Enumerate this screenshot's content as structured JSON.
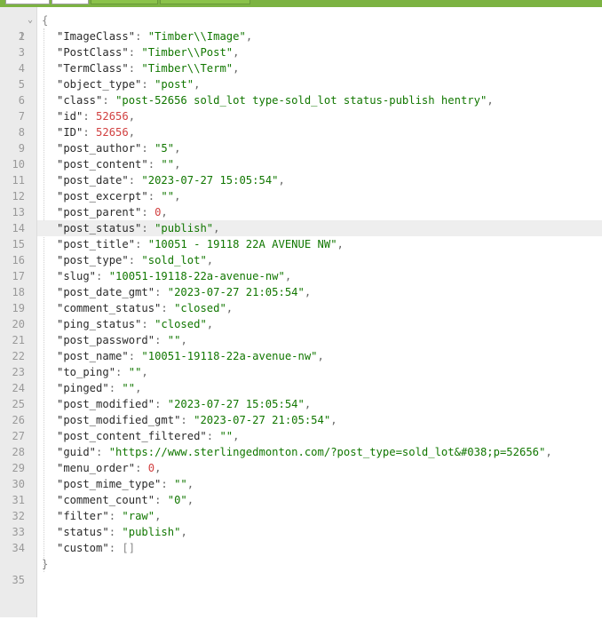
{
  "colors": {
    "accent": "#7cb342",
    "string": "#117700",
    "number": "#d14040",
    "key": "#2b2b2b",
    "punctuation": "#666666",
    "gutter": "#ebebeb"
  },
  "editor": {
    "active_line": 14,
    "fold_icon": "chevron-down-icon",
    "open_brace": "{",
    "close_brace": "}",
    "lines": [
      {
        "n": "2",
        "k": "\"ImageClass\"",
        "t": "str",
        "v": "\"Timber\\\\Image\""
      },
      {
        "n": "3",
        "k": "\"PostClass\"",
        "t": "str",
        "v": "\"Timber\\\\Post\""
      },
      {
        "n": "4",
        "k": "\"TermClass\"",
        "t": "str",
        "v": "\"Timber\\\\Term\""
      },
      {
        "n": "5",
        "k": "\"object_type\"",
        "t": "str",
        "v": "\"post\""
      },
      {
        "n": "6",
        "k": "\"class\"",
        "t": "str",
        "v": "\"post-52656 sold_lot type-sold_lot status-publish hentry\""
      },
      {
        "n": "7",
        "k": "\"id\"",
        "t": "num",
        "v": "52656"
      },
      {
        "n": "8",
        "k": "\"ID\"",
        "t": "num",
        "v": "52656"
      },
      {
        "n": "9",
        "k": "\"post_author\"",
        "t": "str",
        "v": "\"5\""
      },
      {
        "n": "10",
        "k": "\"post_content\"",
        "t": "str",
        "v": "\"\""
      },
      {
        "n": "11",
        "k": "\"post_date\"",
        "t": "str",
        "v": "\"2023-07-27 15:05:54\""
      },
      {
        "n": "12",
        "k": "\"post_excerpt\"",
        "t": "str",
        "v": "\"\""
      },
      {
        "n": "13",
        "k": "\"post_parent\"",
        "t": "num",
        "v": "0"
      },
      {
        "n": "14",
        "k": "\"post_status\"",
        "t": "str",
        "v": "\"publish\""
      },
      {
        "n": "15",
        "k": "\"post_title\"",
        "t": "str",
        "v": "\"10051 - 19118 22A AVENUE NW\""
      },
      {
        "n": "16",
        "k": "\"post_type\"",
        "t": "str",
        "v": "\"sold_lot\""
      },
      {
        "n": "17",
        "k": "\"slug\"",
        "t": "str",
        "v": "\"10051-19118-22a-avenue-nw\""
      },
      {
        "n": "18",
        "k": "\"post_date_gmt\"",
        "t": "str",
        "v": "\"2023-07-27 21:05:54\""
      },
      {
        "n": "19",
        "k": "\"comment_status\"",
        "t": "str",
        "v": "\"closed\""
      },
      {
        "n": "20",
        "k": "\"ping_status\"",
        "t": "str",
        "v": "\"closed\""
      },
      {
        "n": "21",
        "k": "\"post_password\"",
        "t": "str",
        "v": "\"\""
      },
      {
        "n": "22",
        "k": "\"post_name\"",
        "t": "str",
        "v": "\"10051-19118-22a-avenue-nw\""
      },
      {
        "n": "23",
        "k": "\"to_ping\"",
        "t": "str",
        "v": "\"\""
      },
      {
        "n": "24",
        "k": "\"pinged\"",
        "t": "str",
        "v": "\"\""
      },
      {
        "n": "25",
        "k": "\"post_modified\"",
        "t": "str",
        "v": "\"2023-07-27 15:05:54\""
      },
      {
        "n": "26",
        "k": "\"post_modified_gmt\"",
        "t": "str",
        "v": "\"2023-07-27 21:05:54\""
      },
      {
        "n": "27",
        "k": "\"post_content_filtered\"",
        "t": "str",
        "v": "\"\""
      },
      {
        "n": "28",
        "k": "\"guid\"",
        "t": "str",
        "v": "\"https://www.sterlingedmonton.com/?post_type=sold_lot&#038;p=52656\""
      },
      {
        "n": "29",
        "k": "\"menu_order\"",
        "t": "num",
        "v": "0"
      },
      {
        "n": "30",
        "k": "\"post_mime_type\"",
        "t": "str",
        "v": "\"\""
      },
      {
        "n": "31",
        "k": "\"comment_count\"",
        "t": "str",
        "v": "\"0\""
      },
      {
        "n": "32",
        "k": "\"filter\"",
        "t": "str",
        "v": "\"raw\""
      },
      {
        "n": "33",
        "k": "\"status\"",
        "t": "str",
        "v": "\"publish\""
      },
      {
        "n": "34",
        "k": "\"custom\"",
        "t": "arr",
        "v": "[]"
      }
    ],
    "first_line_number": "1",
    "last_line_number": "35"
  }
}
